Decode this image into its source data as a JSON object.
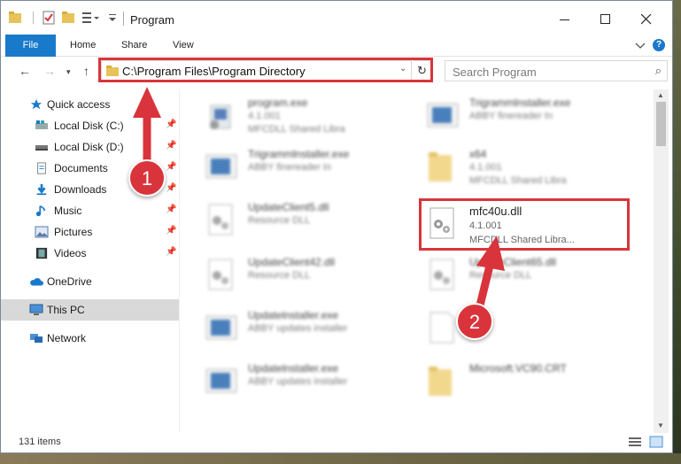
{
  "window": {
    "title": "Program",
    "controls": {
      "minimize": "—",
      "maximize": "☐",
      "close": "✕"
    }
  },
  "ribbon": {
    "tabs": [
      "File",
      "Home",
      "Share",
      "View"
    ],
    "help": "?"
  },
  "address": {
    "path": "C:\\Program Files\\Program Directory",
    "search_placeholder": "Search Program"
  },
  "nav_pane": {
    "items": [
      {
        "label": "Quick access",
        "icon": "star-icon"
      },
      {
        "label": "Local Disk (C:)",
        "icon": "drive-icon"
      },
      {
        "label": "Local Disk (D:)",
        "icon": "drive-icon"
      },
      {
        "label": "Documents",
        "icon": "documents-icon"
      },
      {
        "label": "Downloads",
        "icon": "download-icon"
      },
      {
        "label": "Music",
        "icon": "music-icon"
      },
      {
        "label": "Pictures",
        "icon": "pictures-icon"
      },
      {
        "label": "Videos",
        "icon": "videos-icon"
      },
      {
        "label": "OneDrive",
        "icon": "cloud-icon"
      },
      {
        "label": "This PC",
        "icon": "computer-icon"
      },
      {
        "label": "Network",
        "icon": "network-icon"
      }
    ]
  },
  "files": [
    {
      "name": "program.exe",
      "ver": "4.1.001",
      "desc": "MFCDLL Shared Libra"
    },
    {
      "name": "Trigrammlnstaller.exe",
      "ver": "ABBY finereader In",
      "desc": ""
    },
    {
      "name": "Trigrammlnstaller.exe",
      "ver": "ABBY finereader In",
      "desc": ""
    },
    {
      "name": "x64",
      "ver": "4.1.001",
      "desc": "MFCDLL Shared Libra"
    },
    {
      "name": "UpdateClient5.dll",
      "ver": "Resource DLL",
      "desc": ""
    },
    {
      "name": "mfc40u.dll",
      "ver": "4.1.001",
      "desc": "MFCDLL Shared Libra..."
    },
    {
      "name": "UpdateClient42.dll",
      "ver": "Resource DLL",
      "desc": ""
    },
    {
      "name": "UpdateClient65.dll",
      "ver": "Resource DLL",
      "desc": ""
    },
    {
      "name": "Updatelnstaller.exe",
      "ver": "ABBY updates installer",
      "desc": ""
    },
    {
      "name": "",
      "ver": "",
      "desc": ""
    },
    {
      "name": "Updatelnstaller.exe",
      "ver": "ABBY updates installer",
      "desc": ""
    },
    {
      "name": "Microsoft.VC90.CRT",
      "ver": "",
      "desc": ""
    }
  ],
  "status": {
    "count": "131 items"
  },
  "callouts": {
    "one": "1",
    "two": "2"
  },
  "colors": {
    "accent": "#1979ca",
    "highlight": "#d9343b"
  }
}
